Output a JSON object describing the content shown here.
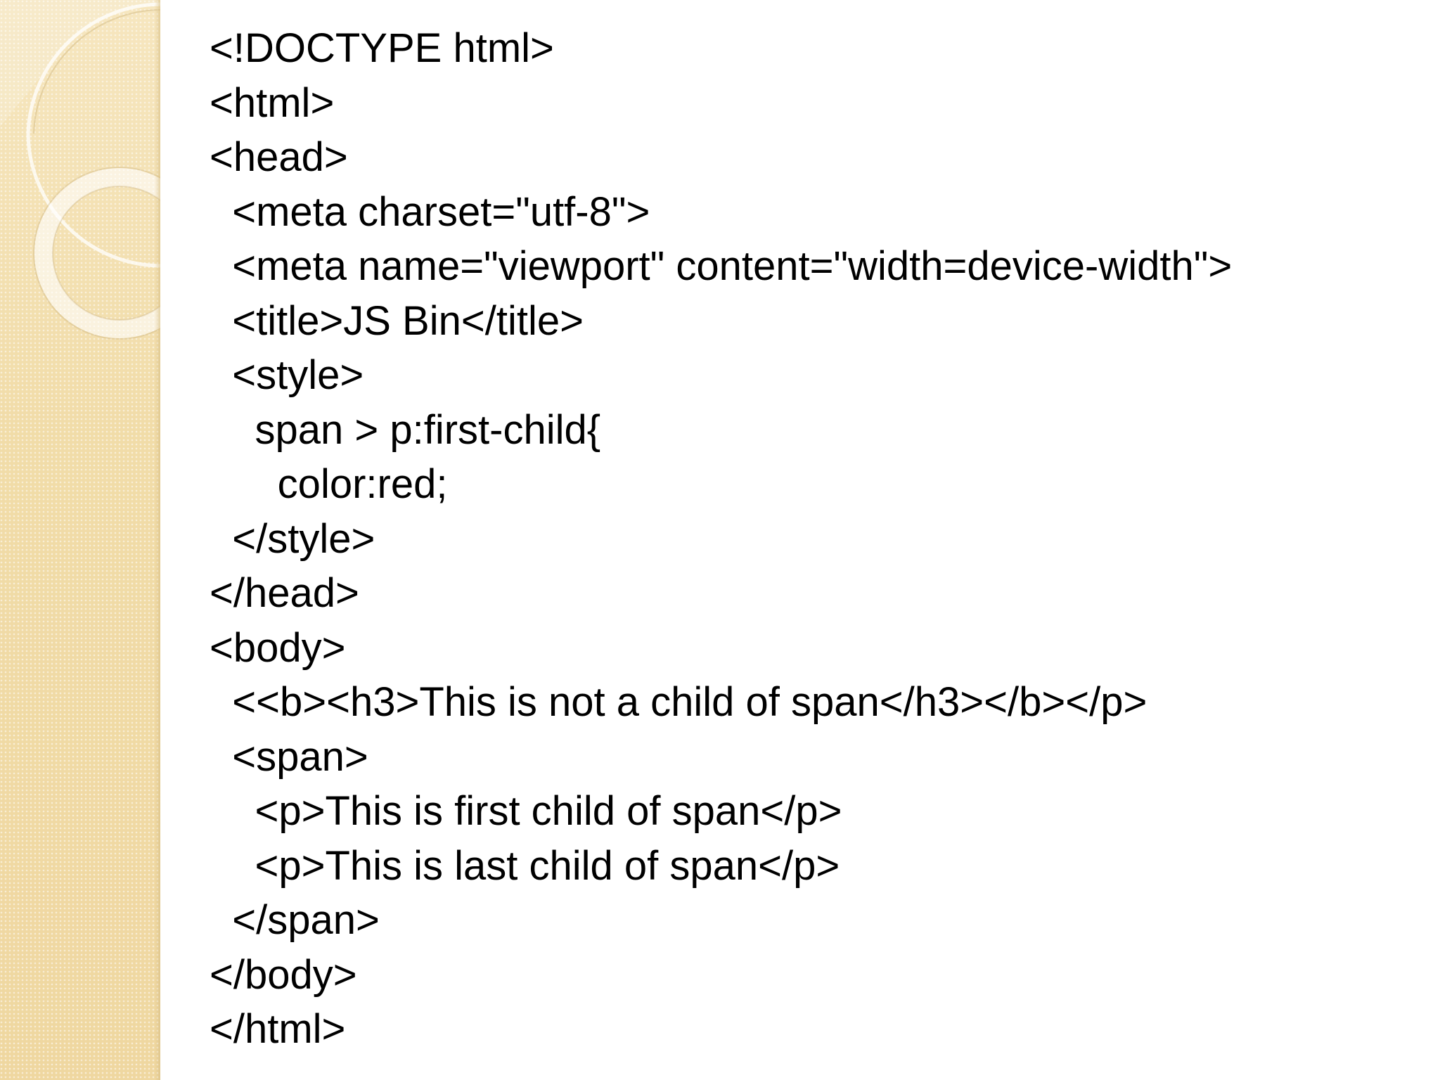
{
  "slide": {
    "code_lines": [
      "<!DOCTYPE html>",
      "<html>",
      "<head>",
      "  <meta charset=\"utf-8\">",
      "  <meta name=\"viewport\" content=\"width=device-width\">",
      "  <title>JS Bin</title>",
      "  <style>",
      "    span > p:first-child{",
      "      color:red;",
      "  </style>",
      "</head>",
      "<body>",
      "  <<b><h3>This is not a child of span</h3></b></p>",
      "  <span>",
      "    <p>This is first child of span</p>",
      "    <p>This is last child of span</p>",
      "  </span>",
      "</body>",
      "</html>"
    ]
  },
  "theme": {
    "background": "#ffffff",
    "side_panel": "#f3dfae",
    "text": "#000000"
  }
}
